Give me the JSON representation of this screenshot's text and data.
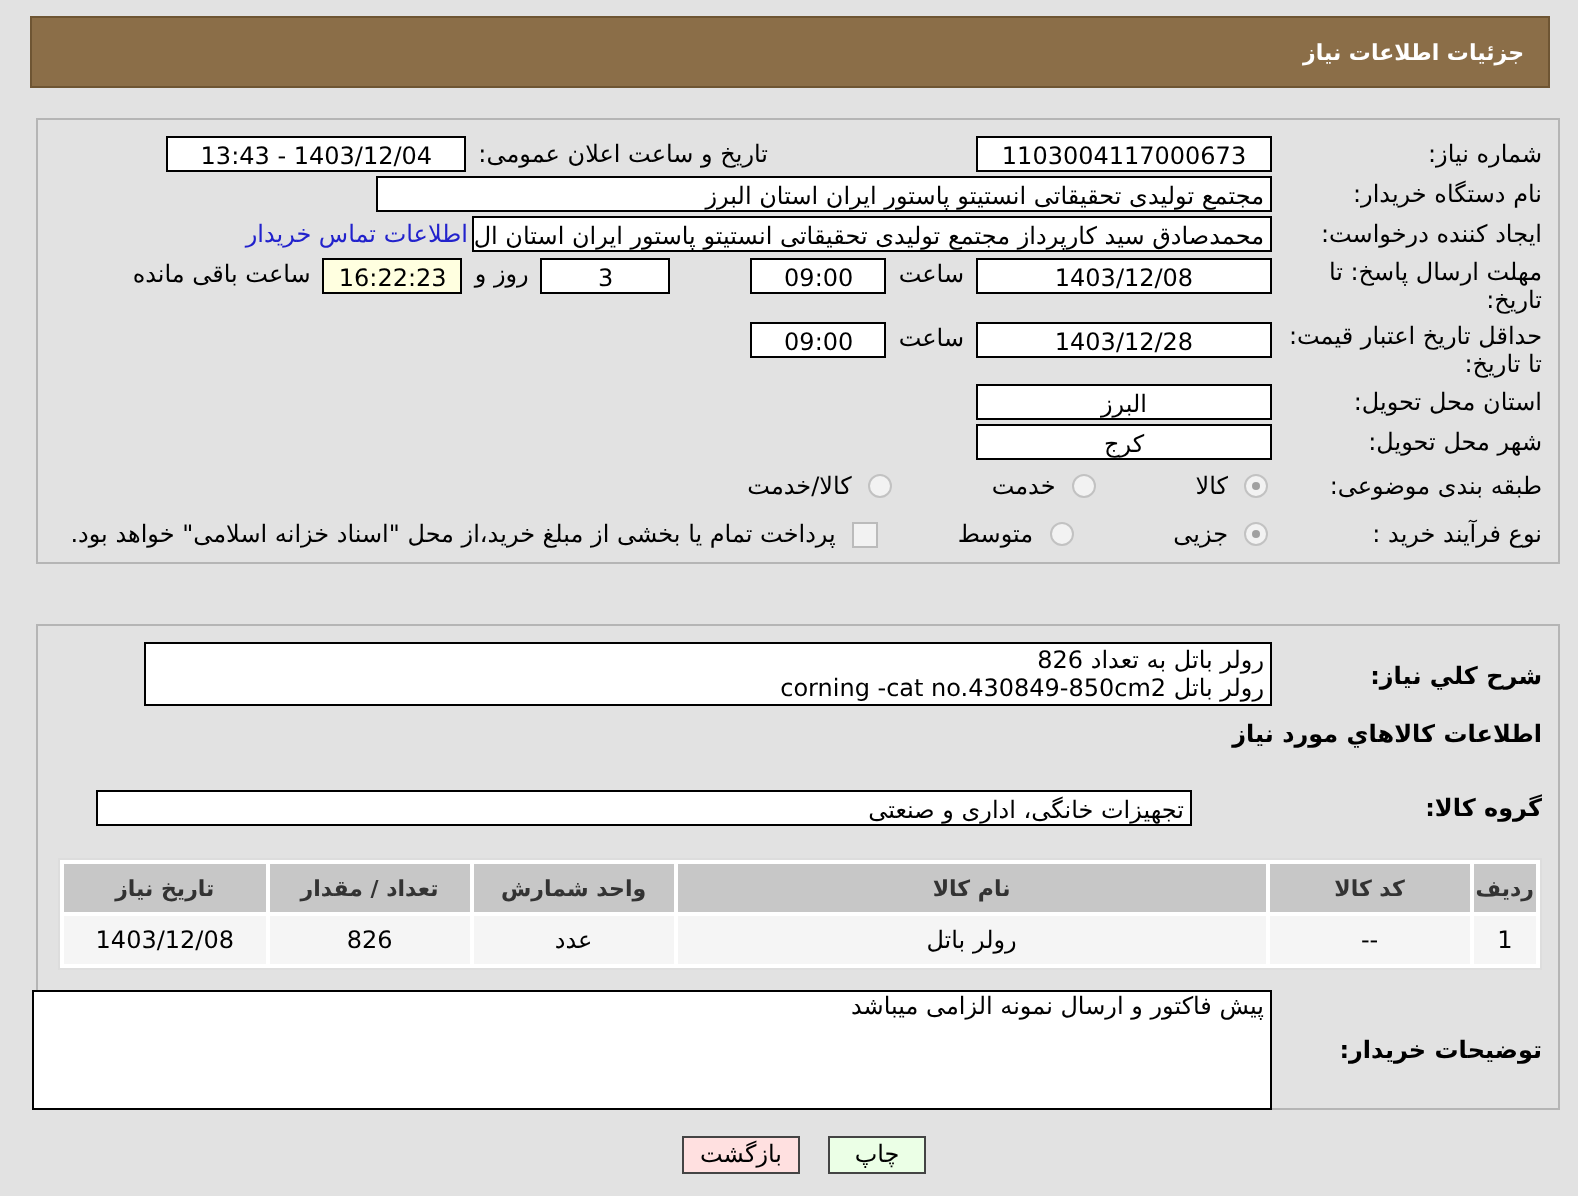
{
  "header": {
    "title": "جزئیات اطلاعات نیاز"
  },
  "need_number": {
    "label": "شماره نیاز:",
    "value": "1103004117000673"
  },
  "announce": {
    "label": "تاریخ و ساعت اعلان عمومی:",
    "value": "1403/12/04 - 13:43"
  },
  "buyer_org": {
    "label": "نام دستگاه خریدار:",
    "value": "مجتمع تولیدی تحقیقاتی انستیتو پاستور ایران استان البرز"
  },
  "requester": {
    "label": "ایجاد کننده درخواست:",
    "value": "محمدصادق سید کارپرداز مجتمع تولیدی تحقیقاتی انستیتو پاستور ایران استان ال",
    "link": "اطلاعات تماس خریدار"
  },
  "reply_deadline": {
    "label": "مهلت ارسال پاسخ: تا تاریخ:",
    "date": "1403/12/08",
    "time_label": "ساعت",
    "time": "09:00",
    "days": "3",
    "days_label": "روز و",
    "remaining": "16:22:23",
    "remaining_label": "ساعت باقی مانده"
  },
  "price_validity": {
    "label": "حداقل تاریخ اعتبار قیمت: تا تاریخ:",
    "date": "1403/12/28",
    "time_label": "ساعت",
    "time": "09:00"
  },
  "province": {
    "label": "استان محل تحویل:",
    "value": "البرز"
  },
  "city": {
    "label": "شهر محل تحویل:",
    "value": "کرج"
  },
  "category": {
    "label": "طبقه بندی موضوعی:",
    "options": [
      {
        "label": "کالا",
        "selected": true
      },
      {
        "label": "خدمت",
        "selected": false
      },
      {
        "label": "کالا/خدمت",
        "selected": false
      }
    ]
  },
  "process": {
    "label": "نوع فرآیند خرید :",
    "options": [
      {
        "label": "جزیی",
        "selected": true
      },
      {
        "label": "متوسط",
        "selected": false
      }
    ],
    "payment_note": {
      "label": "پرداخت تمام یا بخشی از مبلغ خرید،از محل \"اسناد خزانه اسلامی\" خواهد بود.",
      "checked": false
    }
  },
  "description": {
    "label": "شرح کلي نياز:",
    "lines": [
      "رولر باتل به تعداد 826",
      "رولر باتل corning -cat no.430849-850cm2"
    ]
  },
  "goods_heading": "اطلاعات کالاهاي مورد نياز",
  "goods_group": {
    "label": "گروه کالا:",
    "value": "تجهیزات خانگی، اداری و صنعتی"
  },
  "table": {
    "columns": [
      "ردیف",
      "کد کالا",
      "نام کالا",
      "واحد شمارش",
      "تعداد / مقدار",
      "تاریخ نیاز"
    ],
    "rows": [
      [
        "1",
        "--",
        "رولر باتل",
        "عدد",
        "826",
        "1403/12/08"
      ]
    ]
  },
  "buyer_notes": {
    "label": "توضیحات خریدار:",
    "value": "پیش فاکتور و ارسال نمونه الزامی میباشد"
  },
  "buttons": [
    {
      "label": "چاپ",
      "kind": "print"
    },
    {
      "label": "بازگشت",
      "kind": "back"
    }
  ]
}
